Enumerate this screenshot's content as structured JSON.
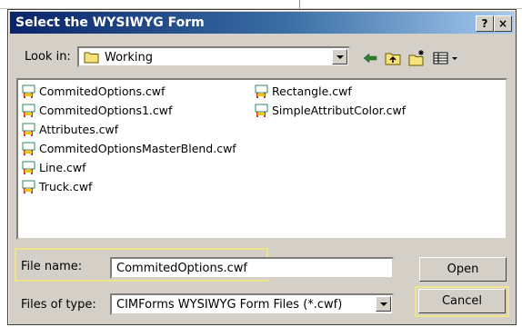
{
  "dialog": {
    "title": "Select the WYSIWYG Form",
    "help_button": "?",
    "close_button": "×"
  },
  "lookin": {
    "label": "Look in:",
    "folder": "Working"
  },
  "files": [
    {
      "name": "CommitedOptions.cwf"
    },
    {
      "name": "CommitedOptions1.cwf"
    },
    {
      "name": "Attributes.cwf"
    },
    {
      "name": "CommitedOptionsMasterBlend.cwf"
    },
    {
      "name": "Line.cwf"
    },
    {
      "name": "Truck.cwf"
    },
    {
      "name": "Rectangle.cwf"
    },
    {
      "name": "SimpleAttributColor.cwf"
    }
  ],
  "filename": {
    "label": "File name:",
    "value": "CommitedOptions.cwf"
  },
  "filetype": {
    "label": "Files of type:",
    "value": "CIMForms WYSIWYG Form Files (*.cwf)"
  },
  "buttons": {
    "open": "Open",
    "cancel": "Cancel"
  },
  "colors": {
    "title_start": "#0a246a",
    "title_end": "#a6caf0",
    "highlight": "#ece58c",
    "dialog_bg": "#d4d0c8"
  }
}
